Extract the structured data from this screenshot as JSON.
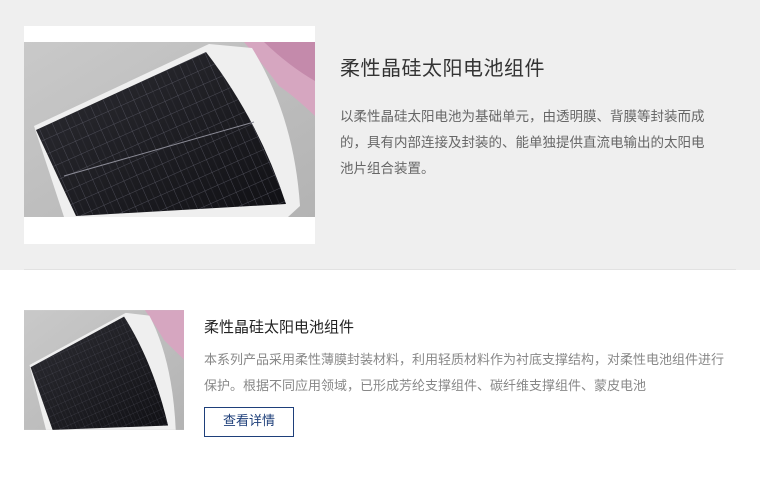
{
  "hero": {
    "title": "柔性晶硅太阳电池组件",
    "description": "以柔性晶硅太阳电池为基础单元，由透明膜、背膜等封装而成的，具有内部连接及封装的、能单独提供直流电输出的太阳电池片组合装置。"
  },
  "product_card": {
    "title": "柔性晶硅太阳电池组件",
    "description": "本系列产品采用柔性薄膜封装材料，利用轻质材料作为衬底支撑结构，对柔性电池组件进行保护。根据不同应用领域，已形成芳纶支撑组件、碳纤维支撑组件、蒙皮电池",
    "button_label": "查看详情"
  },
  "colors": {
    "hero_background": "#efefef",
    "button_border": "#1e3f7a"
  }
}
